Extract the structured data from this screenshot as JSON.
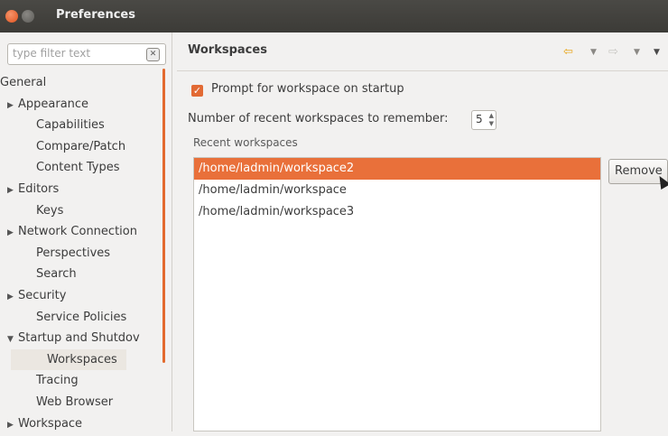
{
  "window": {
    "title": "Preferences"
  },
  "sidebar": {
    "filter_placeholder": "type filter text",
    "items": [
      {
        "label": "General",
        "twisty": "expanded"
      },
      {
        "label": "Appearance",
        "twisty": "collapsed"
      },
      {
        "label": "Capabilities",
        "twisty": ""
      },
      {
        "label": "Compare/Patch",
        "twisty": ""
      },
      {
        "label": "Content Types",
        "twisty": ""
      },
      {
        "label": "Editors",
        "twisty": "collapsed"
      },
      {
        "label": "Keys",
        "twisty": ""
      },
      {
        "label": "Network Connection",
        "twisty": "collapsed"
      },
      {
        "label": "Perspectives",
        "twisty": ""
      },
      {
        "label": "Search",
        "twisty": ""
      },
      {
        "label": "Security",
        "twisty": "collapsed"
      },
      {
        "label": "Service Policies",
        "twisty": ""
      },
      {
        "label": "Startup and Shutdov",
        "twisty": "expanded"
      },
      {
        "label": "Workspaces",
        "twisty": "",
        "selected": true
      },
      {
        "label": "Tracing",
        "twisty": ""
      },
      {
        "label": "Web Browser",
        "twisty": ""
      },
      {
        "label": "Workspace",
        "twisty": "collapsed"
      }
    ]
  },
  "page": {
    "title": "Workspaces",
    "prompt_checkbox_label": "Prompt for workspace on startup",
    "prompt_checked": true,
    "recent_count_label": "Number of recent workspaces to remember:",
    "recent_count_value": "5",
    "recent_label": "Recent workspaces",
    "recent_workspaces": [
      "/home/ladmin/workspace2",
      "/home/ladmin/workspace",
      "/home/ladmin/workspace3"
    ],
    "selected_index": 0,
    "remove_label": "Remove"
  },
  "colors": {
    "accent": "#e9703a",
    "titlebar": "#3c3b37"
  }
}
